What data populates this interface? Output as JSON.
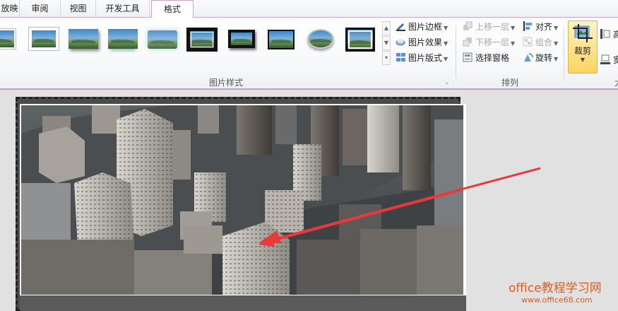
{
  "tabs": [
    {
      "label": "放映",
      "active": false
    },
    {
      "label": "审阅",
      "active": false
    },
    {
      "label": "视图",
      "active": false
    },
    {
      "label": "开发工具",
      "active": false
    },
    {
      "label": "格式",
      "active": true
    }
  ],
  "picture_styles": {
    "group_label": "图片样式",
    "border_label": "图片边框",
    "effects_label": "图片效果",
    "layout_label": "图片版式"
  },
  "arrange": {
    "group_label": "排列",
    "bring_forward": "上移一层",
    "send_backward": "下移一层",
    "selection_pane": "选择窗格",
    "align": "对齐",
    "group": "组合",
    "rotate": "旋转"
  },
  "size": {
    "crop_label": "裁剪",
    "height_partial": "高",
    "width_partial": "宽",
    "group_partial": "大"
  },
  "watermark": {
    "line1": "office教程学习网",
    "line2": "www.office68.com"
  },
  "colors": {
    "accent_border": "#c79ec6",
    "crop_highlight": "#ffd35e",
    "arrow": "#e8393d",
    "watermark": "#e35b1f"
  }
}
